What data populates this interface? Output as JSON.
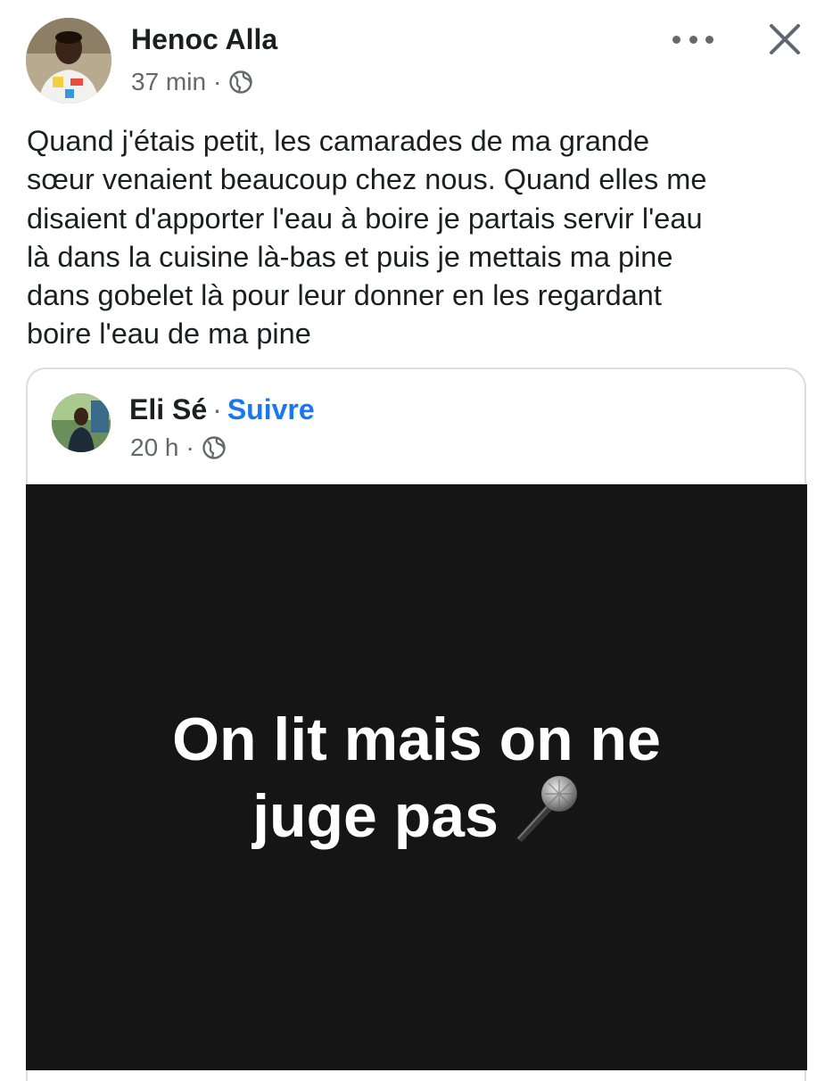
{
  "post": {
    "author": "Henoc Alla",
    "time": "37 min",
    "separator": "·",
    "audience_icon": "globe-icon",
    "menu_icon": "more-horizontal-icon",
    "close_icon": "close-icon",
    "text_lines": [
      "Quand j'étais petit, les camarades de ma grande",
      "sœur venaient beaucoup chez nous. Quand elles me",
      "disaient d'apporter l'eau à boire je partais servir l'eau",
      "là dans la cuisine là-bas et puis je mettais ma pine",
      "dans gobelet là pour leur donner en les regardant",
      "boire l'eau de ma pine"
    ]
  },
  "shared_post": {
    "author": "Eli Sé",
    "separator": "·",
    "follow_label": "Suivre",
    "time": "20 h",
    "audience_icon": "globe-icon",
    "image_text_lines": [
      "On lit mais on ne",
      "juge pas"
    ],
    "image_emoji": "microphone-icon"
  },
  "colors": {
    "link_blue": "#1877f2",
    "secondary_text": "#65676b",
    "image_background": "#151515"
  }
}
